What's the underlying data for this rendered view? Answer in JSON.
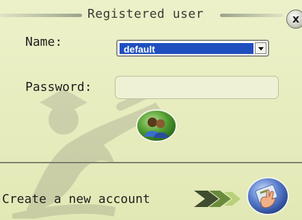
{
  "dialog": {
    "title": "Registered user",
    "close_label": "x"
  },
  "form": {
    "name_label": "Name:",
    "name_value": "default",
    "password_label": "Password:",
    "password_value": ""
  },
  "footer": {
    "create_account_label": "Create a new account"
  },
  "icons": {
    "login": "users-login-icon",
    "create": "hand-card-icon",
    "watermark": "graduate-figure-icon"
  },
  "colors": {
    "background": "#e7ecbe",
    "select_highlight": "#1f4fbf",
    "accent_green": "#4d9a2f",
    "accent_blue": "#3a5fb0"
  }
}
